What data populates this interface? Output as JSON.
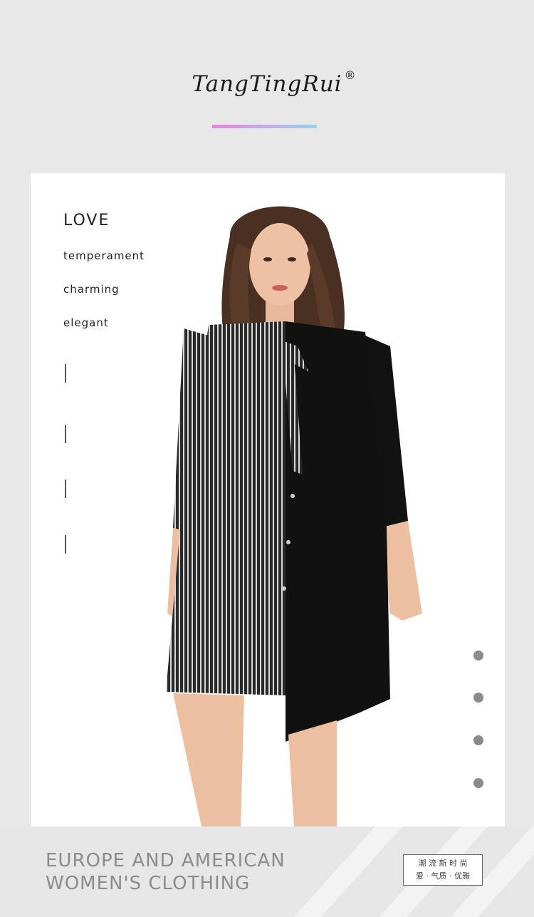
{
  "brand": {
    "name": "TangTingRui",
    "registered": "®"
  },
  "card": {
    "headline": "LOVE",
    "keywords": [
      "temperament",
      "charming",
      "elegant"
    ],
    "dots_count": 4
  },
  "footer": {
    "slogan_line1": "EUROPE AND AMERICAN",
    "slogan_line2": "WOMEN'S CLOTHING",
    "stamp_line1": "潮 流 新 时 尚",
    "stamp_line2": "爱 · 气质 · 优雅"
  },
  "colors": {
    "background": "#e8e8e8",
    "card": "#ffffff",
    "accent_gradient_start": "#ef7fe0",
    "accent_gradient_end": "#8ed8f2",
    "slogan": "#8c8c8c",
    "dress_black": "#111111"
  }
}
